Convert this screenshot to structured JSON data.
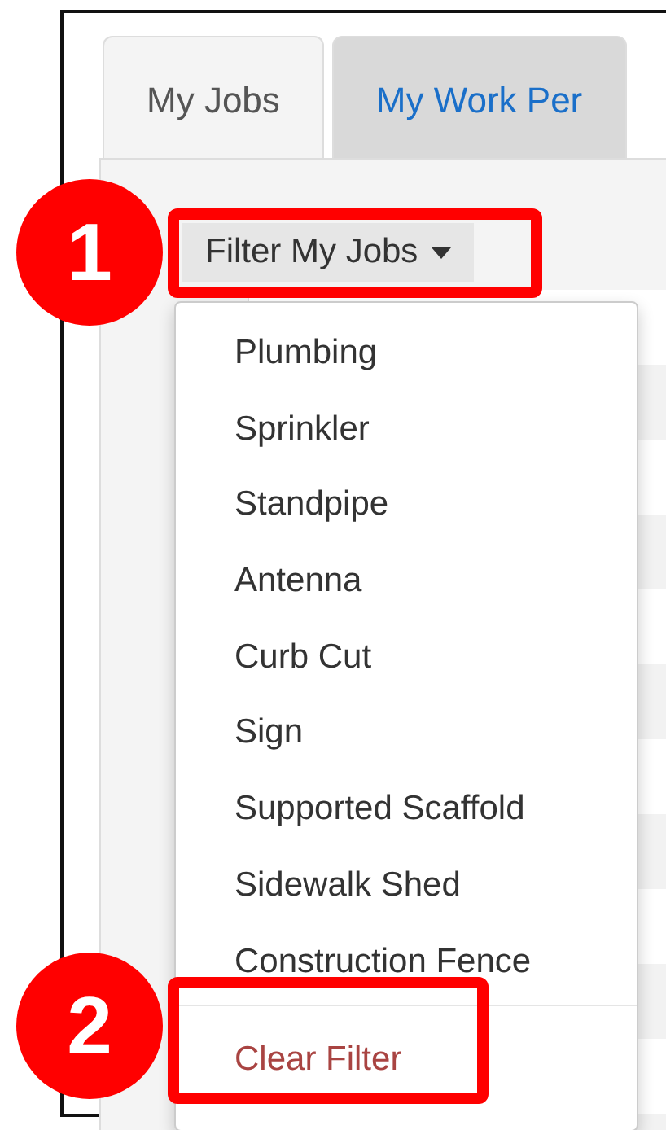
{
  "tabs": [
    {
      "label": "My Jobs",
      "selected": true
    },
    {
      "label": "My Work Per",
      "selected": false
    }
  ],
  "filter_button": {
    "label": "Filter My Jobs",
    "expanded": true
  },
  "menu": {
    "items": [
      "Plumbing",
      "Sprinkler",
      "Standpipe",
      "Antenna",
      "Curb Cut",
      "Sign",
      "Supported Scaffold",
      "Sidewalk Shed",
      "Construction Fence"
    ],
    "clear": "Clear Filter"
  },
  "callouts": [
    {
      "number": "1"
    },
    {
      "number": "2"
    }
  ]
}
